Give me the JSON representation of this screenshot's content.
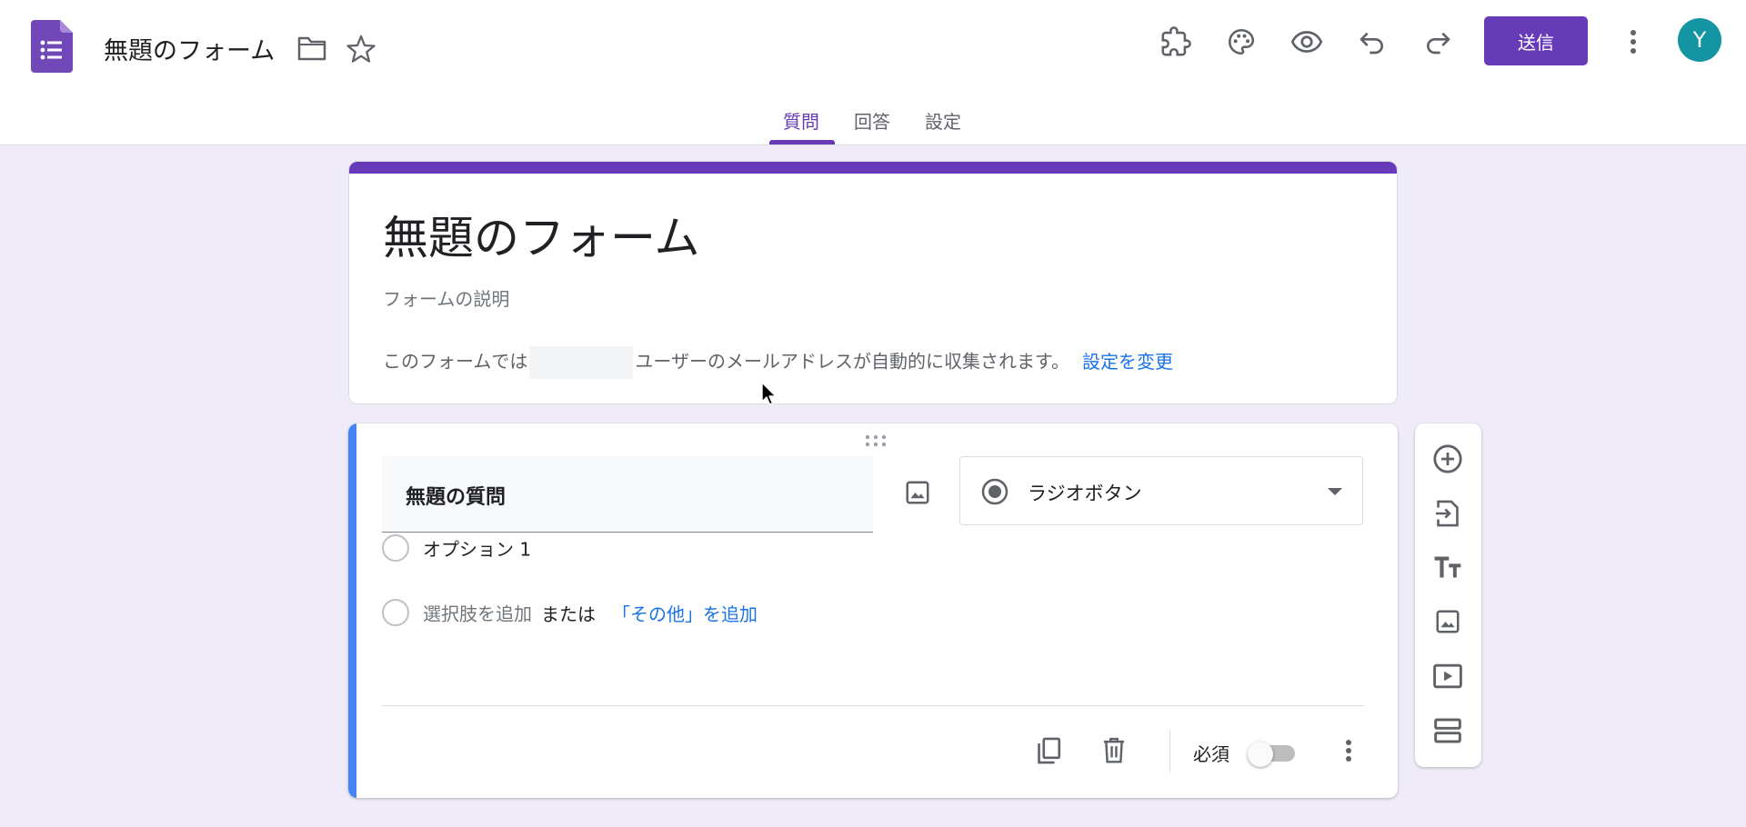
{
  "header": {
    "doc_title": "無題のフォーム",
    "send_label": "送信",
    "avatar_letter": "Y",
    "icons": [
      "addon-puzzle-icon",
      "palette-icon",
      "preview-eye-icon",
      "undo-icon",
      "redo-icon",
      "more-vert-icon"
    ]
  },
  "tabs": [
    {
      "label": "質問",
      "active": true
    },
    {
      "label": "回答",
      "active": false
    },
    {
      "label": "設定",
      "active": false
    }
  ],
  "form": {
    "title": "無題のフォーム",
    "description_placeholder": "フォームの説明",
    "email_note_prefix": "このフォームでは",
    "email_note_suffix": "ユーザーのメールアドレスが自動的に収集されます。",
    "change_settings_link": "設定を変更"
  },
  "question": {
    "title": "無題の質問",
    "type": "ラジオボタン",
    "options": [
      "オプション 1"
    ],
    "add_option": "選択肢を追加",
    "or": "または",
    "add_other": "「その他」を追加",
    "required_label": "必須",
    "required": false
  },
  "colors": {
    "accent": "#673ab7",
    "background": "#f0ebf8",
    "question_bar": "#4285f4",
    "link": "#1a73e8",
    "avatar": "#1595a3"
  }
}
